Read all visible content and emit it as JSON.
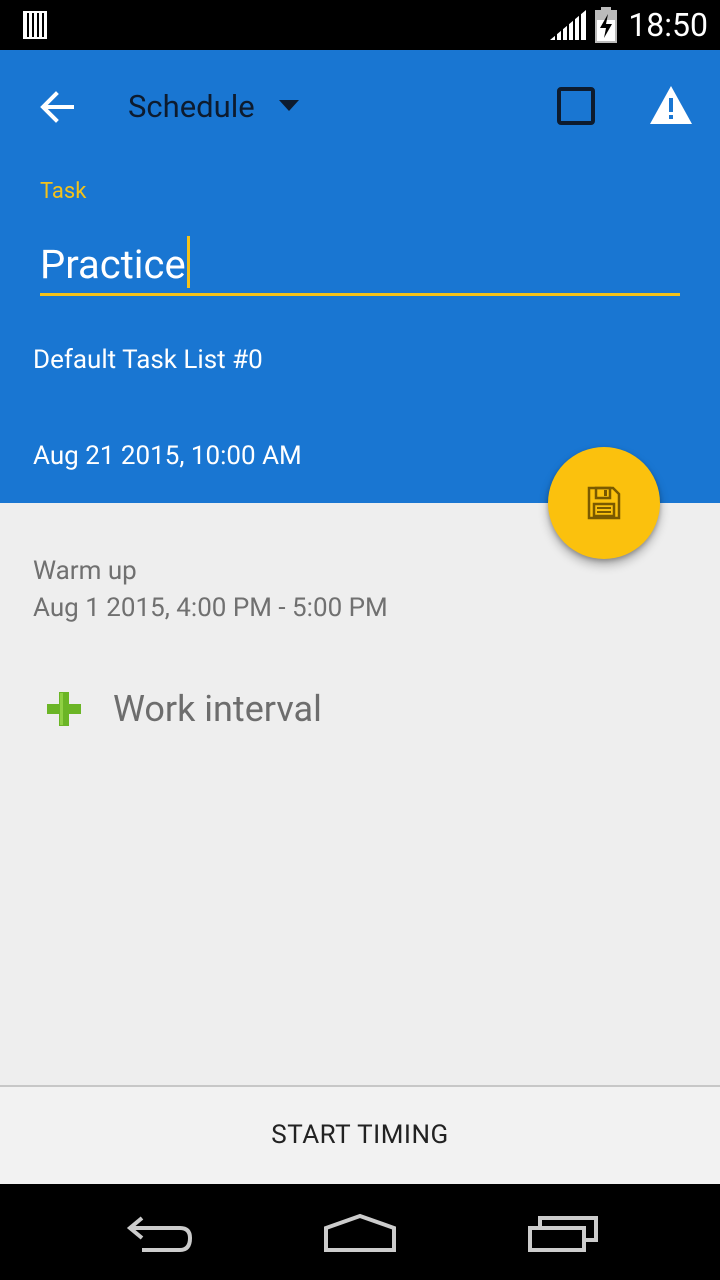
{
  "status_bar": {
    "time": "18:50",
    "icons": [
      "sd-card-icon",
      "signal-icon",
      "battery-charging-icon"
    ]
  },
  "toolbar": {
    "back_icon": "arrow-back-icon",
    "title": "Schedule",
    "dropdown_icon": "dropdown-arrow-icon",
    "checkbox_icon": "checkbox-outline-icon",
    "warning_icon": "warning-icon"
  },
  "task": {
    "label": "Task",
    "value": "Practice",
    "list": "Default Task List #0",
    "date": "Aug 21 2015, 10:00 AM"
  },
  "fab": {
    "icon": "save-icon"
  },
  "intervals": [
    {
      "title": "Warm up",
      "time": "Aug 1 2015, 4:00 PM - 5:00 PM"
    }
  ],
  "add_interval": {
    "icon": "plus-icon",
    "label": "Work interval"
  },
  "bottom_button": {
    "label": "START TIMING"
  },
  "navbar": {
    "icons": [
      "back-nav-icon",
      "home-nav-icon",
      "recents-nav-icon"
    ]
  },
  "colors": {
    "primary": "#1976d2",
    "accent": "#fbc10d",
    "background": "#eeeeee",
    "add_green": "#6bb526"
  }
}
